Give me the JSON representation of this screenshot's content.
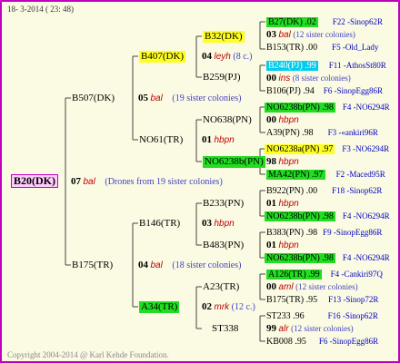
{
  "header": "18-  3-2014 ( 23: 48)",
  "footer": "Copyright 2004-2014 @ Karl Kehde Foundation.",
  "root": {
    "label": "B20(DK)",
    "num": "07",
    "bal": "bal",
    "note": "(Drones from 19 sister colonies)"
  },
  "g1": [
    {
      "label": "B507(DK)",
      "num": "05",
      "bal": "bal",
      "note": "(19 sister colonies)"
    },
    {
      "label": "B175(TR)",
      "num": "04",
      "bal": "bal",
      "note": "(18 sister colonies)"
    }
  ],
  "g2": [
    {
      "label": "B407(DK)",
      "num": "04",
      "bal": "leyh",
      "note": "(8 c.)"
    },
    {
      "label": "NO61(TR)",
      "num": "01",
      "bal": "hbpn",
      "note": ""
    },
    {
      "label": "B146(TR)",
      "num": "03",
      "bal": "hbpn",
      "note": ""
    },
    {
      "label": "A34(TR)",
      "num": "02",
      "bal": "mrk",
      "note": "(12 c.)"
    }
  ],
  "g3": [
    {
      "label": "B32(DK)"
    },
    {
      "label": "B259(PJ)"
    },
    {
      "label": "NO638(PN)"
    },
    {
      "label": "NO6238b(PN)"
    },
    {
      "label": "B233(PN)"
    },
    {
      "label": "B483(PN)"
    },
    {
      "label": "A23(TR)"
    },
    {
      "label": "ST338"
    }
  ],
  "g4": [
    {
      "label": "B27(DK) .02",
      "code": "F22 -Sinop62R"
    },
    {
      "num": "03",
      "bal": "bal",
      "note": "(12 sister colonies)"
    },
    {
      "label": "B153(TR) .00",
      "code": "F5 -Old_Lady"
    },
    {
      "label": "B240(PJ) .99",
      "code": "F11 -AthosSt80R"
    },
    {
      "num": "00",
      "bal": "ins",
      "note": "(8 sister colonies)"
    },
    {
      "label": "B106(PJ) .94",
      "code": "F6 -SinopEgg86R"
    },
    {
      "label": "NO6238b(PN) .98",
      "code": "F4 -NO6294R"
    },
    {
      "num": "00",
      "bal": "hbpn",
      "note": ""
    },
    {
      "label": "A39(PN) .98",
      "code": "F3 -«ankiri96R"
    },
    {
      "label": "NO6238a(PN) .97",
      "code": "F3 -NO6294R"
    },
    {
      "num": "98",
      "bal": "hbpn",
      "note": ""
    },
    {
      "label": "MA42(PN) .97",
      "code": "F2 -Maced95R"
    },
    {
      "label": "B922(PN) .00",
      "code": "F18 -Sinop62R"
    },
    {
      "num": "01",
      "bal": "hbpn",
      "note": ""
    },
    {
      "label": "NO6238b(PN) .98",
      "code": "F4 -NO6294R"
    },
    {
      "label": "B383(PN) .98",
      "code": "F9 -SinopEgg86R"
    },
    {
      "num": "01",
      "bal": "hbpn",
      "note": ""
    },
    {
      "label": "NO6238b(PN) .98",
      "code": "F4 -NO6294R"
    },
    {
      "label": "A126(TR) .99",
      "code": "F4 -Cankiri97Q"
    },
    {
      "num": "00",
      "bal": "aml",
      "note": "(12 sister colonies)"
    },
    {
      "label": "B175(TR) .95",
      "code": "F13 -Sinop72R"
    },
    {
      "label": "ST233 .96",
      "code": "F16 -Sinop62R"
    },
    {
      "num": "99",
      "bal": "alr",
      "note": "(12 sister colonies)"
    },
    {
      "label": "KB008 .95",
      "code": "F6 -SinopEgg86R"
    }
  ]
}
